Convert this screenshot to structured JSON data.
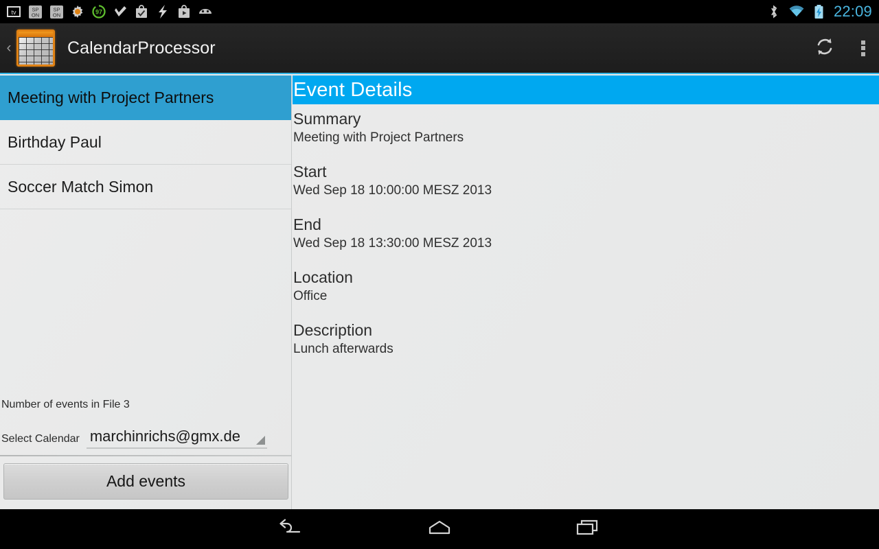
{
  "status_bar": {
    "time": "22:09",
    "notification_icons": [
      "tv-icon",
      "sp-on-icon",
      "sp-on-icon",
      "gear-icon",
      "battery-97-icon",
      "checkmark-icon",
      "bag-checkmark-icon",
      "lightning-bolt-icon",
      "play-store-icon",
      "android-head-icon"
    ],
    "system_icons": [
      "bluetooth-icon",
      "wifi-icon",
      "battery-charging-icon"
    ]
  },
  "action_bar": {
    "up_label": "‹",
    "app_icon": "calendar-grid-icon",
    "title": "CalendarProcessor",
    "refresh_icon": "refresh-icon",
    "overflow_icon": "overflow-menu-icon",
    "accent_color": "#33b5e5"
  },
  "event_list": {
    "items": [
      {
        "title": "Meeting with Project Partners",
        "selected": true
      },
      {
        "title": "Birthday Paul",
        "selected": false
      },
      {
        "title": "Soccer Match Simon",
        "selected": false
      }
    ],
    "selected_color": "#2f9fd0"
  },
  "footer": {
    "events_count_text": "Number of events in File 3",
    "calendar_label": "Select Calendar",
    "calendar_selected": "marchinrichs@gmx.de",
    "calendar_options": [
      "marchinrichs@gmx.de"
    ],
    "add_button_label": "Add events"
  },
  "detail": {
    "header": "Event Details",
    "header_color": "#00a8f0",
    "fields": [
      {
        "label": "Summary",
        "value": "Meeting with Project Partners"
      },
      {
        "label": "Start",
        "value": "Wed Sep 18 10:00:00 MESZ 2013"
      },
      {
        "label": "End",
        "value": "Wed Sep 18 13:30:00 MESZ 2013"
      },
      {
        "label": "Location",
        "value": "Office"
      },
      {
        "label": "Description",
        "value": "Lunch afterwards"
      }
    ]
  },
  "nav_bar": {
    "buttons": [
      "back-icon",
      "home-icon",
      "recents-icon"
    ]
  }
}
